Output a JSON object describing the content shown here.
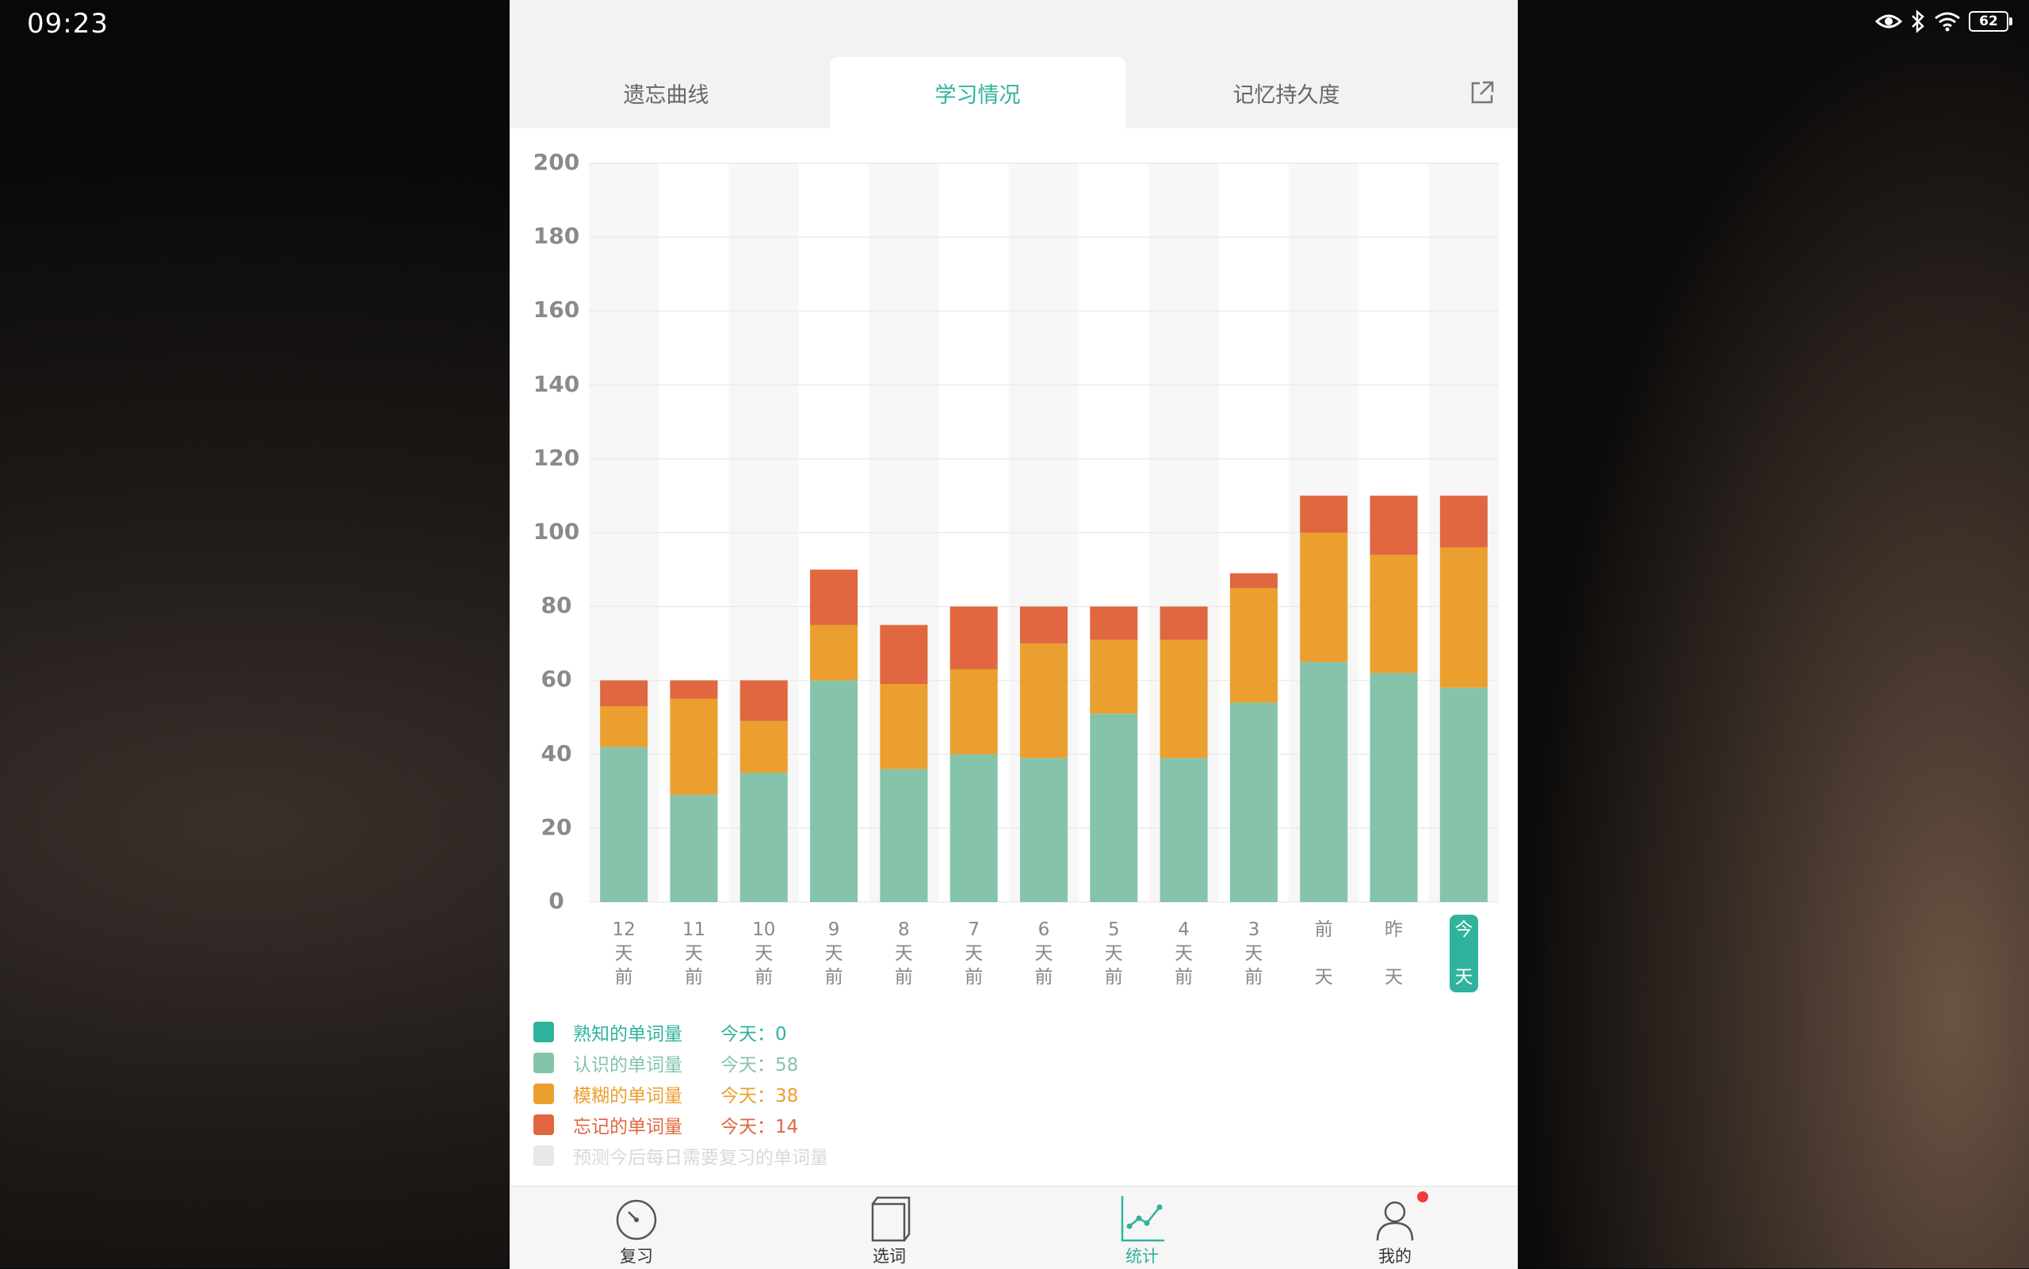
{
  "status_bar": {
    "time": "09:23",
    "battery": "62",
    "icons": [
      "eye-icon",
      "bluetooth-icon",
      "wifi-icon",
      "battery-icon"
    ]
  },
  "tabs": [
    {
      "label": "遗忘曲线",
      "active": false
    },
    {
      "label": "学习情况",
      "active": true
    },
    {
      "label": "记忆持久度",
      "active": false
    }
  ],
  "share_icon": "share-icon",
  "colors": {
    "accent": "#2fb39c",
    "familiar": "#2fb39c",
    "recognized": "#85c4aa",
    "fuzzy": "#eb9f2e",
    "forgot": "#e0673f",
    "forecast": "#e8e8e8"
  },
  "chart_data": {
    "type": "bar",
    "stacked": true,
    "categories": [
      "12\n天\n前",
      "11\n天\n前",
      "10\n天\n前",
      "9\n天\n前",
      "8\n天\n前",
      "7\n天\n前",
      "6\n天\n前",
      "5\n天\n前",
      "4\n天\n前",
      "3\n天\n前",
      "前\n\n天",
      "昨\n\n天",
      "今\n\n天"
    ],
    "selected_category": 12,
    "ylim": [
      0,
      200
    ],
    "yticks": [
      0,
      20,
      40,
      60,
      80,
      100,
      120,
      140,
      160,
      180,
      200
    ],
    "grid": true,
    "series": [
      {
        "name": "熟知的单词量",
        "color": "#2fb39c",
        "values": [
          0,
          0,
          0,
          0,
          0,
          0,
          0,
          0,
          0,
          0,
          0,
          0,
          0
        ]
      },
      {
        "name": "认识的单词量",
        "color": "#85c4aa",
        "values": [
          42,
          29,
          35,
          60,
          36,
          40,
          39,
          51,
          39,
          54,
          65,
          62,
          58
        ]
      },
      {
        "name": "模糊的单词量",
        "color": "#eb9f2e",
        "values": [
          11,
          26,
          14,
          15,
          23,
          23,
          31,
          20,
          32,
          31,
          35,
          32,
          38
        ]
      },
      {
        "name": "忘记的单词量",
        "color": "#e0673f",
        "values": [
          7,
          5,
          11,
          15,
          16,
          17,
          10,
          9,
          9,
          4,
          10,
          16,
          14
        ]
      }
    ]
  },
  "legend": [
    {
      "label": "熟知的单词量",
      "value": "今天：0",
      "color": "#2fb39c"
    },
    {
      "label": "认识的单词量",
      "value": "今天：58",
      "color": "#85c4aa"
    },
    {
      "label": "模糊的单词量",
      "value": "今天：38",
      "color": "#eb9f2e"
    },
    {
      "label": "忘记的单词量",
      "value": "今天：14",
      "color": "#e0673f"
    },
    {
      "label": "预测今后每日需要复习的单词量",
      "value": "",
      "color": "#e8e8e8"
    }
  ],
  "bottom_nav": [
    {
      "label": "复习",
      "icon": "timer-icon",
      "active": false
    },
    {
      "label": "选词",
      "icon": "book-icon",
      "active": false
    },
    {
      "label": "统计",
      "icon": "chart-icon",
      "active": true
    },
    {
      "label": "我的",
      "icon": "user-icon",
      "active": false,
      "badge": true
    }
  ]
}
